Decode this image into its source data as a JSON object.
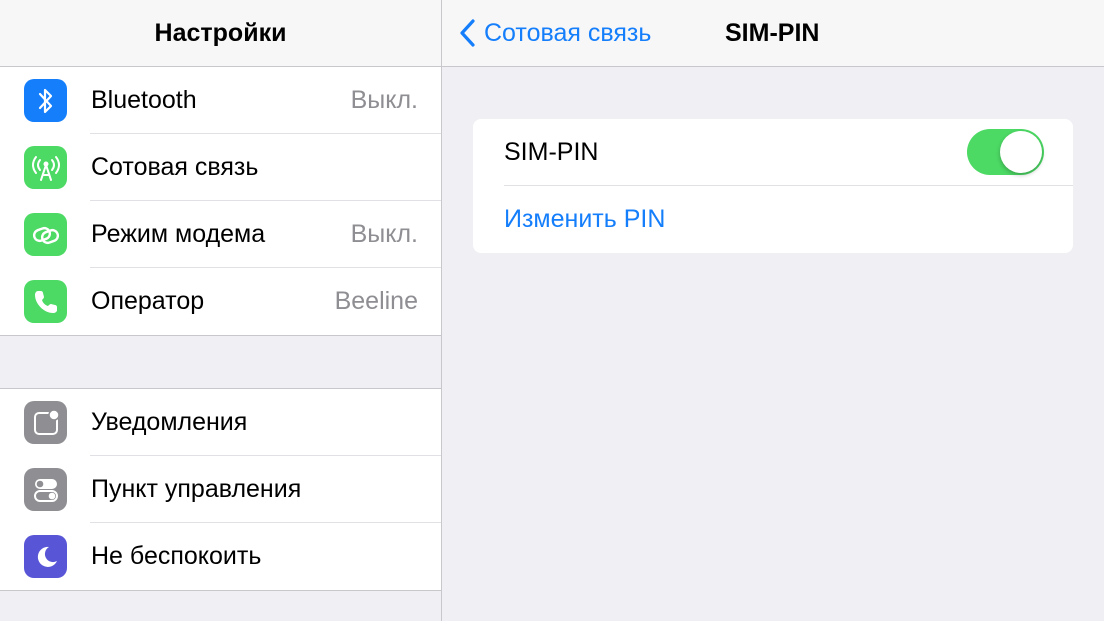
{
  "sidebar": {
    "title": "Настройки",
    "group1": [
      {
        "label": "Bluetooth",
        "value": "Выкл.",
        "icon": "bluetooth-icon",
        "color": "#147efb"
      },
      {
        "label": "Сотовая связь",
        "value": "",
        "icon": "cellular-antenna-icon",
        "color": "#4cd964"
      },
      {
        "label": "Режим модема",
        "value": "Выкл.",
        "icon": "hotspot-chain-icon",
        "color": "#4cd964"
      },
      {
        "label": "Оператор",
        "value": "Beeline",
        "icon": "phone-icon",
        "color": "#4cd964"
      }
    ],
    "group2": [
      {
        "label": "Уведомления",
        "icon": "notifications-icon",
        "color": "#8e8e93"
      },
      {
        "label": "Пункт управления",
        "icon": "control-center-icon",
        "color": "#8e8e93"
      },
      {
        "label": "Не беспокоить",
        "icon": "moon-icon",
        "color": "#5856d6"
      }
    ]
  },
  "detail": {
    "back_label": "Сотовая связь",
    "title": "SIM-PIN",
    "sim_pin_label": "SIM-PIN",
    "sim_pin_enabled": true,
    "change_pin_label": "Изменить PIN"
  },
  "colors": {
    "accent": "#147efb",
    "toggle_on": "#4cd964",
    "background": "#efeff4"
  }
}
